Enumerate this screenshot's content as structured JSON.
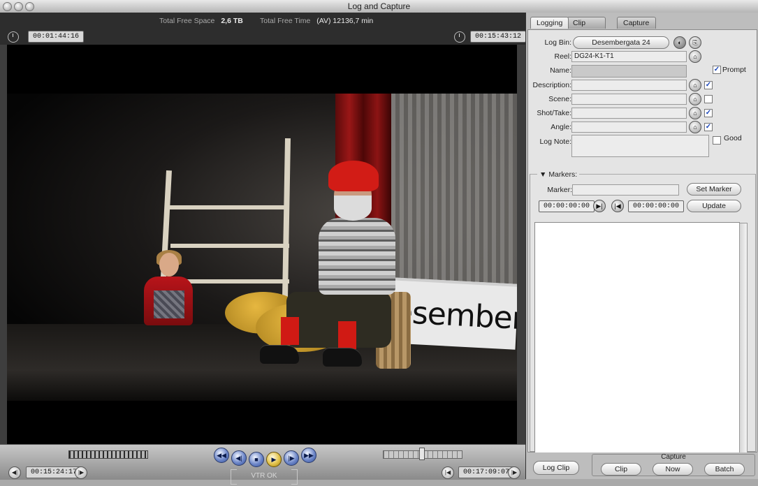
{
  "window": {
    "title": "Log and Capture"
  },
  "viewer": {
    "free_space_label": "Total Free Space",
    "free_space_value": "2,6 TB",
    "free_time_label": "Total Free Time",
    "free_time_value": "(AV) 12136,7 min",
    "duration_tc": "00:01:44:16",
    "current_tc": "00:15:43:12",
    "in_tc": "00:15:24:17",
    "out_tc": "00:17:09:07",
    "vtr_status": "VTR OK",
    "banner_text": "esembergat"
  },
  "panel": {
    "tabs": [
      "Logging",
      "Clip Settings",
      "Capture Settings"
    ],
    "active_tab": "Logging",
    "log_bin_label": "Log Bin:",
    "log_bin_value": "Desembergata 24",
    "reel_label": "Reel:",
    "reel_value": "DG24-K1-T1",
    "name_label": "Name:",
    "prompt_label": "Prompt",
    "description_label": "Description:",
    "scene_label": "Scene:",
    "shot_label": "Shot/Take:",
    "angle_label": "Angle:",
    "lognote_label": "Log Note:",
    "good_label": "Good",
    "markers_label": "Markers:",
    "marker_label": "Marker:",
    "set_marker": "Set Marker",
    "marker_in_tc": "00:00:00:00",
    "marker_out_tc": "00:00:00:00",
    "update": "Update",
    "checks": {
      "prompt": true,
      "description": true,
      "scene": false,
      "shot": true,
      "angle": true,
      "good": false
    }
  },
  "capture": {
    "log_clip": "Log Clip",
    "group_label": "Capture",
    "clip": "Clip",
    "now": "Now",
    "batch": "Batch"
  }
}
